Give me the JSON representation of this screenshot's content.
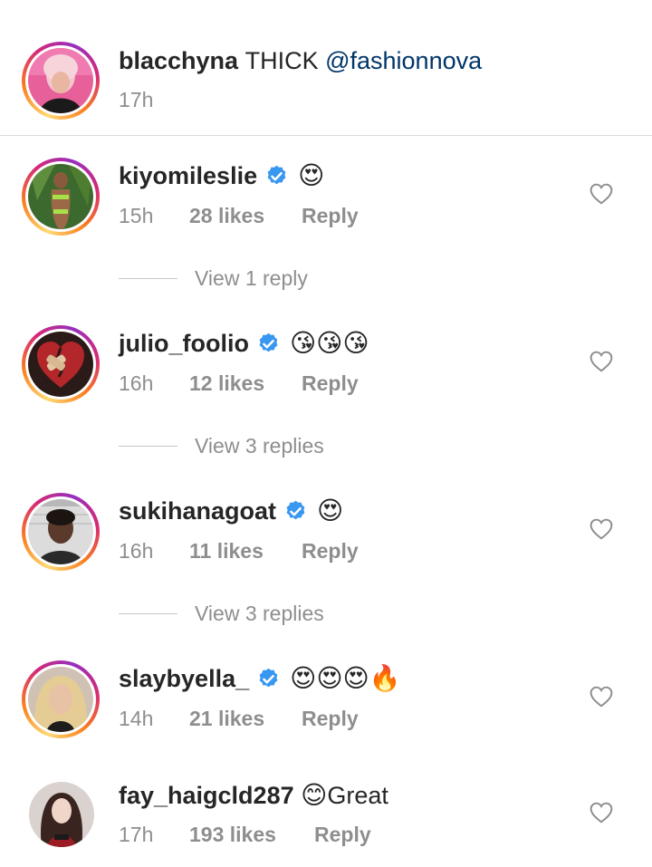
{
  "caption": {
    "username": "blacchyna",
    "text": "THICK",
    "mention": "@fashionnova",
    "time": "17h"
  },
  "comments": [
    {
      "username": "kiyomileslie",
      "verified": true,
      "emojis": "😍",
      "time": "15h",
      "likes": "28 likes",
      "reply": "Reply",
      "view_replies": "View 1 reply"
    },
    {
      "username": "julio_foolio",
      "verified": true,
      "emojis": "😘😘😘",
      "time": "16h",
      "likes": "12 likes",
      "reply": "Reply",
      "view_replies": "View 3 replies"
    },
    {
      "username": "sukihanagoat",
      "verified": true,
      "emojis": "😍",
      "time": "16h",
      "likes": "11 likes",
      "reply": "Reply",
      "view_replies": "View 3 replies"
    },
    {
      "username": "slaybyella_",
      "verified": true,
      "emojis": "😍😍😍🔥",
      "time": "14h",
      "likes": "21 likes",
      "reply": "Reply"
    },
    {
      "username": "fay_haigcld287",
      "verified": false,
      "emojis": "😊",
      "text": "Great",
      "time": "17h",
      "likes": "193 likes",
      "reply": "Reply"
    }
  ],
  "icons": {
    "verified": "verified-badge-icon",
    "like": "heart-outline-icon"
  },
  "colors": {
    "verified_blue": "#3897f0",
    "mention": "#003569",
    "secondary_text": "#8e8e8e"
  }
}
